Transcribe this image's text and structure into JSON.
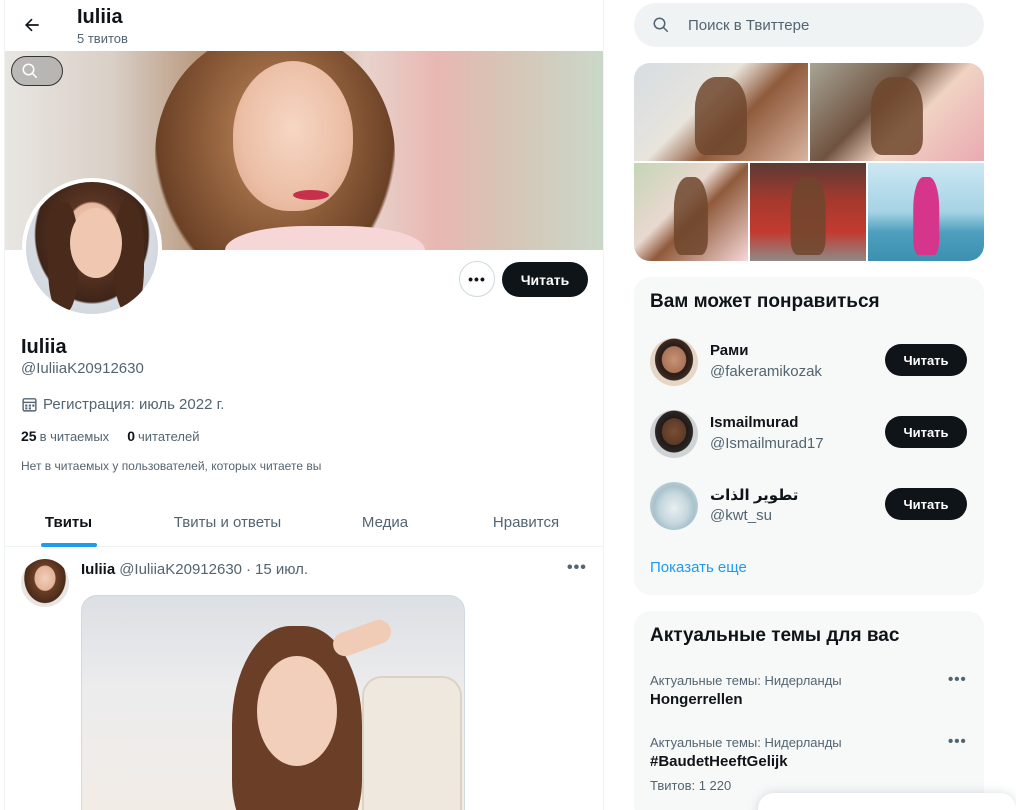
{
  "header": {
    "name": "Iuliia",
    "tweet_count": "5 твитов"
  },
  "profile": {
    "name": "Iuliia",
    "handle": "@IuliiaK20912630",
    "joined": "Регистрация: июль 2022 г.",
    "following_count": "25",
    "following_label": "в читаемых",
    "followers_count": "0",
    "followers_label": "читателей",
    "mutual_note": "Нет в читаемых у пользователей, которых читаете вы",
    "follow_button": "Читать"
  },
  "tabs": [
    {
      "label": "Твиты"
    },
    {
      "label": "Твиты и ответы"
    },
    {
      "label": "Медиа"
    },
    {
      "label": "Нравится"
    }
  ],
  "tweet": {
    "name": "Iuliia",
    "handle": "@IuliiaK20912630",
    "sep": "·",
    "date": "15 июл."
  },
  "search": {
    "placeholder": "Поиск в Твиттере"
  },
  "who_to_follow": {
    "title": "Вам может понравиться",
    "items": [
      {
        "name": "Рами",
        "handle": "@fakeramikozak",
        "button": "Читать"
      },
      {
        "name": "Ismailmurad",
        "handle": "@Ismailmurad17",
        "button": "Читать"
      },
      {
        "name": "تطوير الذات",
        "handle": "@kwt_su",
        "button": "Читать"
      }
    ],
    "show_more": "Показать еще"
  },
  "trends": {
    "title": "Актуальные темы для вас",
    "items": [
      {
        "context": "Актуальные темы: Нидерланды",
        "topic": "Hongerrellen",
        "count": ""
      },
      {
        "context": "Актуальные темы: Нидерланды",
        "topic": "#BaudetHeeftGelijk",
        "count": "Твитов: 1 220"
      }
    ]
  },
  "icons": {
    "back": "arrow-left-icon",
    "search": "search-icon",
    "calendar": "calendar-icon",
    "more": "more-dots-icon"
  },
  "colors": {
    "accent": "#1d9bf0",
    "text": "#0f1419",
    "muted": "#536471",
    "button": "#0f1419",
    "card": "#f7f9f9"
  }
}
